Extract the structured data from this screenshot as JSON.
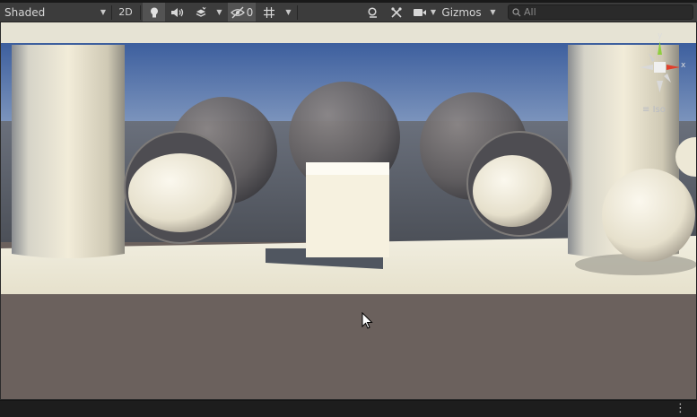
{
  "toolbar": {
    "draw_mode": "Shaded",
    "mode_2d": "2D",
    "hidden_count": "0",
    "gizmos": "Gizmos",
    "search_placeholder": "All"
  },
  "orientation_gizmo": {
    "axis_y": "y",
    "axis_x": "x",
    "projection": "Iso"
  },
  "colors": {
    "toolbar_bg": "#3c3c3c",
    "sky": "#4a6fb0",
    "ground": "#6b615d",
    "axis_y": "#8fce3e",
    "axis_x": "#e0402c"
  },
  "icons": [
    "dropdown-caret-icon",
    "lighting-icon",
    "audio-icon",
    "effects-icon",
    "visibility-icon",
    "grid-icon",
    "search-icon",
    "tools-icon",
    "camera-icon",
    "kebab-menu-icon",
    "mouse-cursor-icon"
  ]
}
